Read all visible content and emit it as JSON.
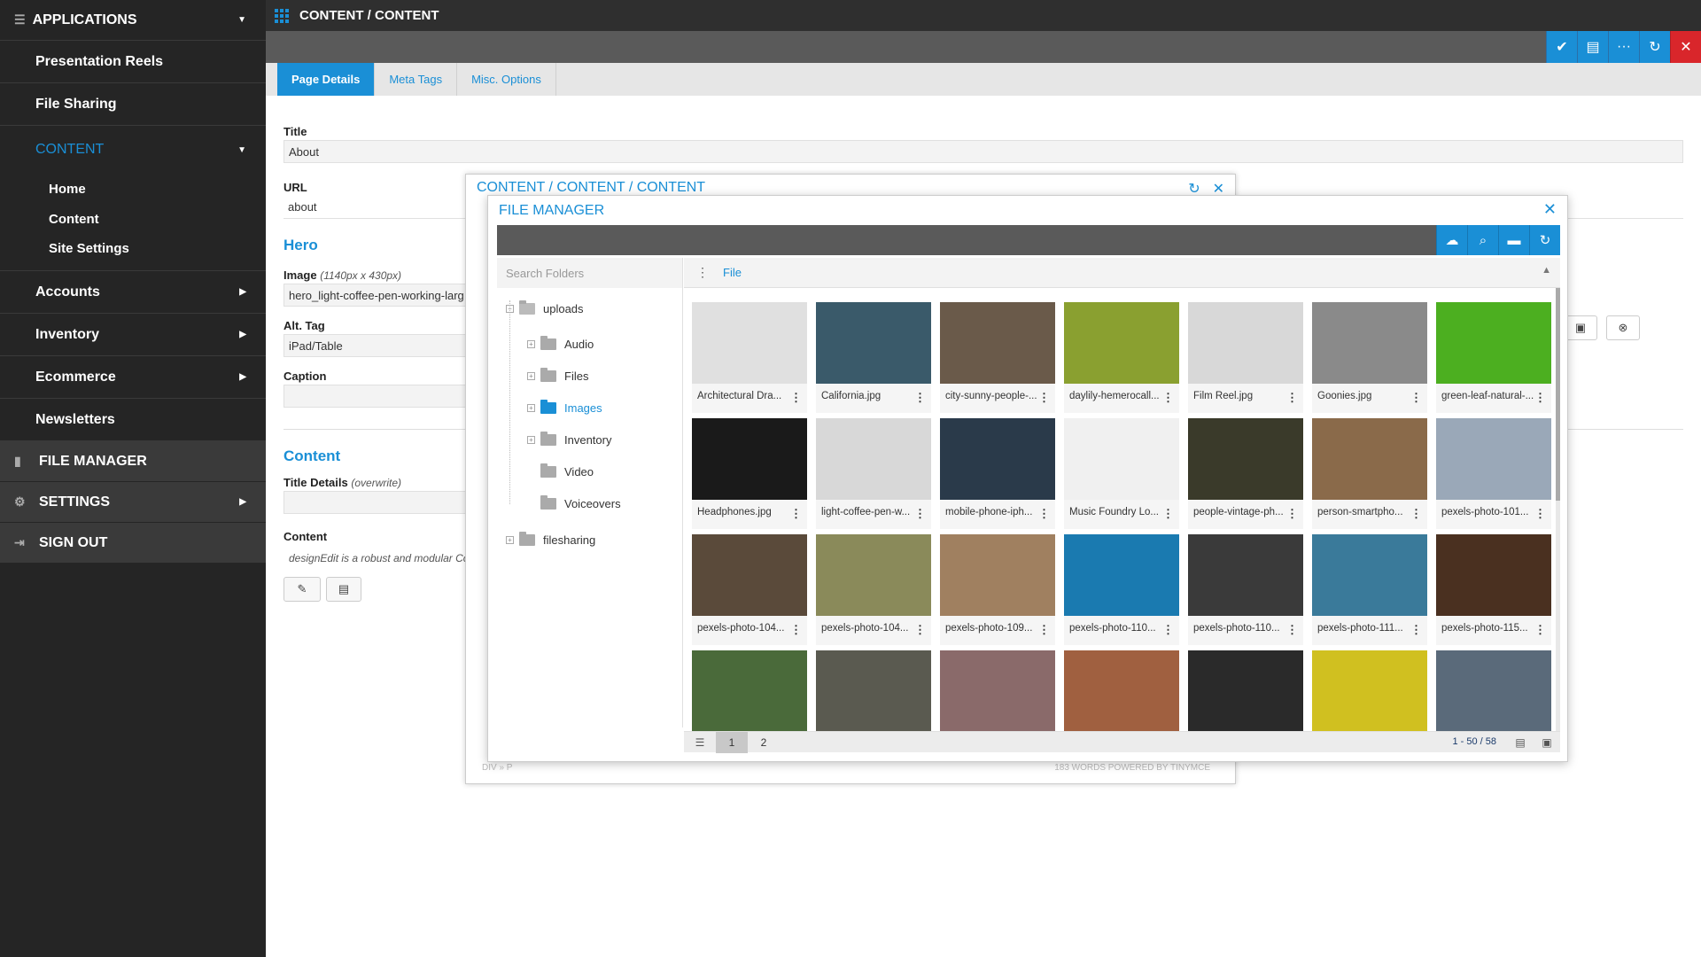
{
  "sidebar": {
    "header": "APPLICATIONS",
    "items": [
      {
        "label": "Presentation Reels"
      },
      {
        "label": "File Sharing"
      }
    ],
    "content_section": "CONTENT",
    "content_items": [
      {
        "label": "Home"
      },
      {
        "label": "Content"
      },
      {
        "label": "Site Settings"
      }
    ],
    "more_items": [
      {
        "label": "Accounts"
      },
      {
        "label": "Inventory"
      },
      {
        "label": "Ecommerce"
      },
      {
        "label": "Newsletters"
      }
    ],
    "file_manager": "FILE MANAGER",
    "settings": "SETTINGS",
    "sign_out": "SIGN OUT"
  },
  "topbar": {
    "title": "CONTENT / CONTENT"
  },
  "tabs": [
    {
      "label": "Page Details"
    },
    {
      "label": "Meta Tags"
    },
    {
      "label": "Misc. Options"
    }
  ],
  "form": {
    "title_label": "Title",
    "title_value": "About",
    "url_label": "URL",
    "url_value": "about",
    "hero_heading": "Hero",
    "image_label": "Image",
    "image_hint": "(1140px x 430px)",
    "image_value": "hero_light-coffee-pen-working-larg",
    "alt_label": "Alt. Tag",
    "alt_value": "iPad/Table",
    "caption_label": "Caption",
    "content_heading": "Content",
    "title_details_label": "Title Details",
    "title_details_hint": "(overwrite)",
    "content_label": "Content",
    "content_preview": "designEdit is a robust and modular Co"
  },
  "editor": {
    "title": "CONTENT / CONTENT / CONTENT",
    "footer_left": "DIV » P",
    "footer_right": "183 WORDS POWERED BY TINYMCE"
  },
  "file_manager": {
    "title": "FILE MANAGER",
    "search_placeholder": "Search Folders",
    "column_header": "File",
    "tree": {
      "root": "uploads",
      "children": [
        "Audio",
        "Files",
        "Images",
        "Inventory",
        "Video",
        "Voiceovers"
      ],
      "other": "filesharing"
    },
    "files": [
      {
        "name": "Architectural Dra...",
        "color": "#e0e0e0"
      },
      {
        "name": "California.jpg",
        "color": "#3a5a6a"
      },
      {
        "name": "city-sunny-people-...",
        "color": "#6a5a4a"
      },
      {
        "name": "daylily-hemerocall...",
        "color": "#8aa030"
      },
      {
        "name": "Film Reel.jpg",
        "color": "#d8d8d8"
      },
      {
        "name": "Goonies.jpg",
        "color": "#8a8a8a"
      },
      {
        "name": "green-leaf-natural-...",
        "color": "#4caf20"
      },
      {
        "name": "Headphones.jpg",
        "color": "#1a1a1a"
      },
      {
        "name": "light-coffee-pen-w...",
        "color": "#d8d8d8"
      },
      {
        "name": "mobile-phone-iph...",
        "color": "#2a3a4a"
      },
      {
        "name": "Music Foundry Lo...",
        "color": "#f0f0f0"
      },
      {
        "name": "people-vintage-ph...",
        "color": "#3a3a2a"
      },
      {
        "name": "person-smartpho...",
        "color": "#8a6a4a"
      },
      {
        "name": "pexels-photo-101...",
        "color": "#9aa8b8"
      },
      {
        "name": "pexels-photo-104...",
        "color": "#5a4a3a"
      },
      {
        "name": "pexels-photo-104...",
        "color": "#8a8a5a"
      },
      {
        "name": "pexels-photo-109...",
        "color": "#a08060"
      },
      {
        "name": "pexels-photo-110...",
        "color": "#1a7ab0"
      },
      {
        "name": "pexels-photo-110...",
        "color": "#3a3a3a"
      },
      {
        "name": "pexels-photo-111...",
        "color": "#3a7a9a"
      },
      {
        "name": "pexels-photo-115...",
        "color": "#4a3020"
      },
      {
        "name": "",
        "color": "#4a6a3a"
      },
      {
        "name": "",
        "color": "#5a5a50"
      },
      {
        "name": "",
        "color": "#8a6a6a"
      },
      {
        "name": "",
        "color": "#a06040"
      },
      {
        "name": "",
        "color": "#2a2a2a"
      },
      {
        "name": "",
        "color": "#d0c020"
      },
      {
        "name": "",
        "color": "#5a6a7a"
      }
    ],
    "pages": [
      "1",
      "2"
    ],
    "count": "1 - 50 / 58"
  },
  "colors": {
    "accent": "#1a8fd6",
    "danger": "#d9262b",
    "sidebar": "#252525"
  }
}
